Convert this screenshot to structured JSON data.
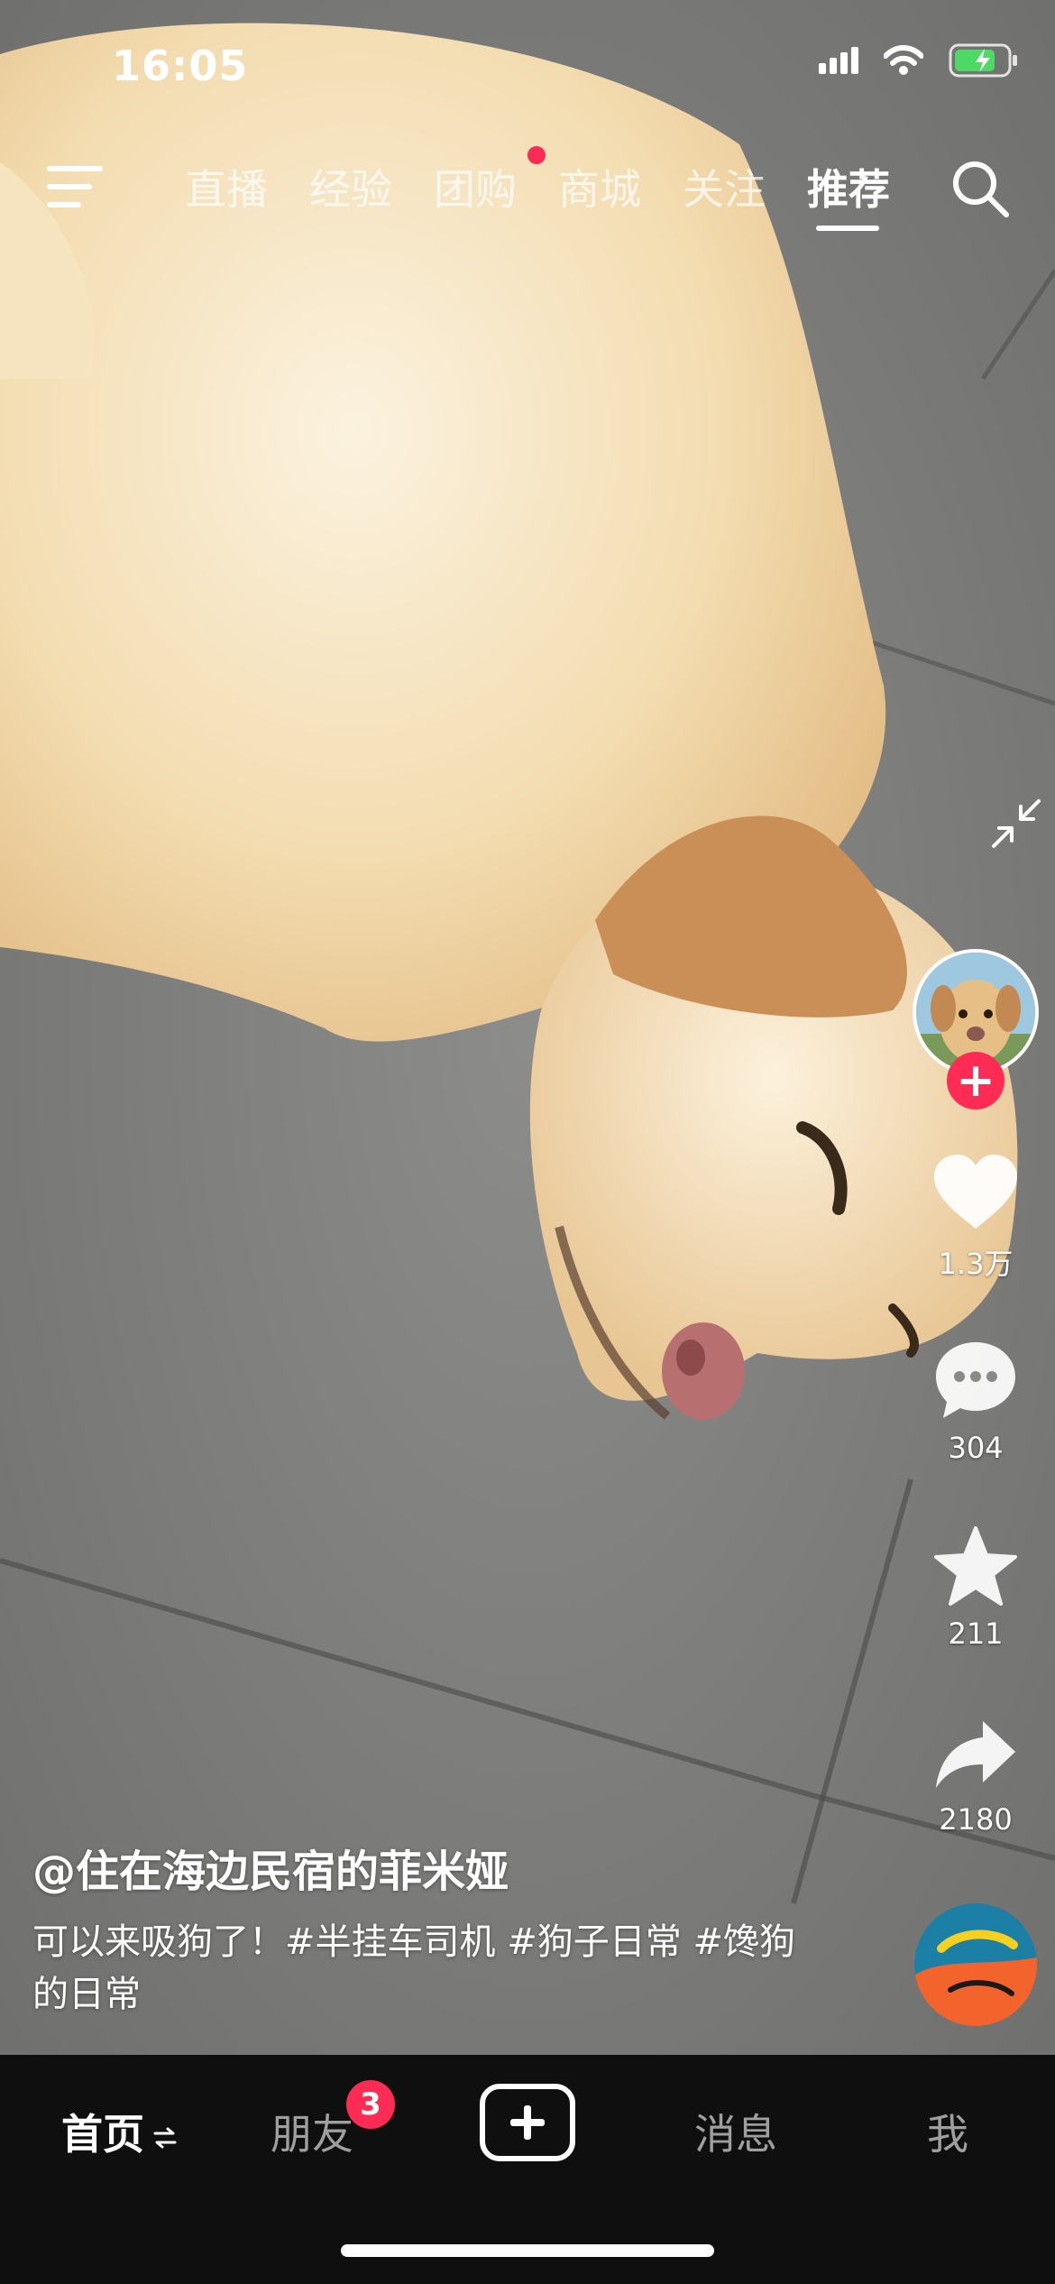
{
  "status_bar": {
    "time": "16:05"
  },
  "top_nav": {
    "tabs": [
      {
        "label": "直播",
        "active": false,
        "dot": false
      },
      {
        "label": "经验",
        "active": false,
        "dot": false
      },
      {
        "label": "团购",
        "active": false,
        "dot": true
      },
      {
        "label": "商城",
        "active": false,
        "dot": false
      },
      {
        "label": "关注",
        "active": false,
        "dot": false
      },
      {
        "label": "推荐",
        "active": true,
        "dot": false
      }
    ]
  },
  "right_rail": {
    "likes": "1.3万",
    "comments": "304",
    "favorites": "211",
    "shares": "2180",
    "follow_symbol": "+"
  },
  "video": {
    "author": "@住在海边民宿的菲米娅",
    "caption": "可以来吸狗了！#半挂车司机 #狗子日常 #馋狗的日常"
  },
  "bottom_nav": {
    "home": "首页",
    "friends": "朋友",
    "friends_badge": "3",
    "messages": "消息",
    "me": "我"
  },
  "colors": {
    "accent": "#fe2c55",
    "bar_bg": "#0f0f0f"
  }
}
